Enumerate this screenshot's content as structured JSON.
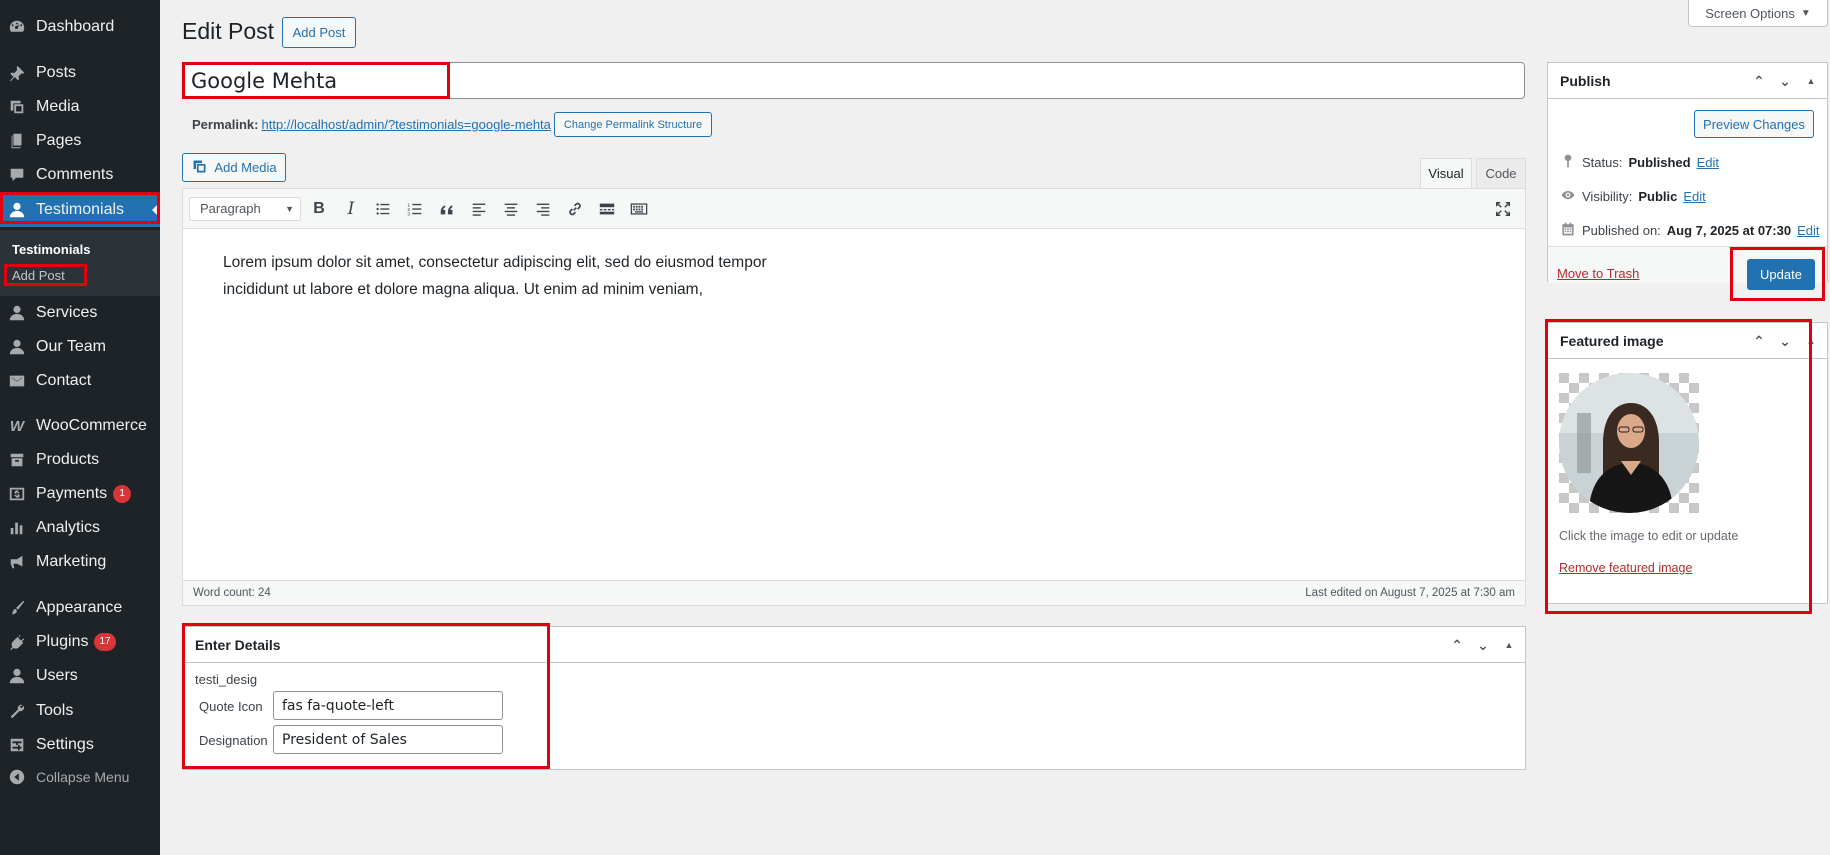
{
  "sidebar": {
    "items": [
      {
        "label": "Dashboard",
        "icon": "dashboard-icon"
      },
      {
        "label": "Posts",
        "icon": "pin-icon"
      },
      {
        "label": "Media",
        "icon": "media-icon"
      },
      {
        "label": "Pages",
        "icon": "pages-icon"
      },
      {
        "label": "Comments",
        "icon": "comment-icon"
      },
      {
        "label": "Testimonials",
        "icon": "user-icon"
      },
      {
        "label": "Services",
        "icon": "user-icon"
      },
      {
        "label": "Our Team",
        "icon": "user-icon"
      },
      {
        "label": "Contact",
        "icon": "mail-icon"
      },
      {
        "label": "WooCommerce",
        "icon": "woo-icon"
      },
      {
        "label": "Products",
        "icon": "archive-icon"
      },
      {
        "label": "Payments",
        "icon": "money-icon",
        "badge": "1"
      },
      {
        "label": "Analytics",
        "icon": "chart-bar-icon"
      },
      {
        "label": "Marketing",
        "icon": "megaphone-icon"
      },
      {
        "label": "Appearance",
        "icon": "brush-icon"
      },
      {
        "label": "Plugins",
        "icon": "plugin-icon",
        "badge": "17"
      },
      {
        "label": "Users",
        "icon": "user-icon"
      },
      {
        "label": "Tools",
        "icon": "wrench-icon"
      },
      {
        "label": "Settings",
        "icon": "settings-icon"
      }
    ],
    "submenu": {
      "title": "Testimonials",
      "add": "Add Post"
    },
    "collapse_label": "Collapse Menu"
  },
  "header": {
    "title": "Edit Post",
    "add_button": "Add Post",
    "screen_options": "Screen Options"
  },
  "post": {
    "title": "Google Mehta",
    "permalink_label": "Permalink:",
    "permalink_url": "http://localhost/admin/?testimonials=google-mehta",
    "change_permalink": "Change Permalink Structure"
  },
  "editor": {
    "add_media": "Add Media",
    "tab_visual": "Visual",
    "tab_code": "Code",
    "format": "Paragraph",
    "content_line1": "Lorem ipsum dolor sit amet, consectetur adipiscing elit, sed do eiusmod tempor",
    "content_line2": "incididunt ut labore et dolore magna aliqua. Ut enim ad minim veniam,",
    "word_count": "Word count: 24",
    "last_edited": "Last edited on August 7, 2025 at 7:30 am"
  },
  "details": {
    "title": "Enter Details",
    "subtitle": "testi_desig",
    "quote_icon_label": "Quote Icon",
    "quote_icon_value": "fas fa-quote-left",
    "designation_label": "Designation",
    "designation_value": "President of Sales"
  },
  "publish": {
    "title": "Publish",
    "preview": "Preview Changes",
    "status_label": "Status:",
    "status_value": "Published",
    "visibility_label": "Visibility:",
    "visibility_value": "Public",
    "published_label": "Published on:",
    "published_value": "Aug 7, 2025 at 07:30",
    "edit": "Edit",
    "trash": "Move to Trash",
    "update": "Update"
  },
  "featured": {
    "title": "Featured image",
    "help": "Click the image to edit or update",
    "remove": "Remove featured image"
  },
  "colors": {
    "sidebar_bg": "#1d2327",
    "accent": "#2271b1",
    "highlight": "#e0000f",
    "badge": "#d63638"
  }
}
